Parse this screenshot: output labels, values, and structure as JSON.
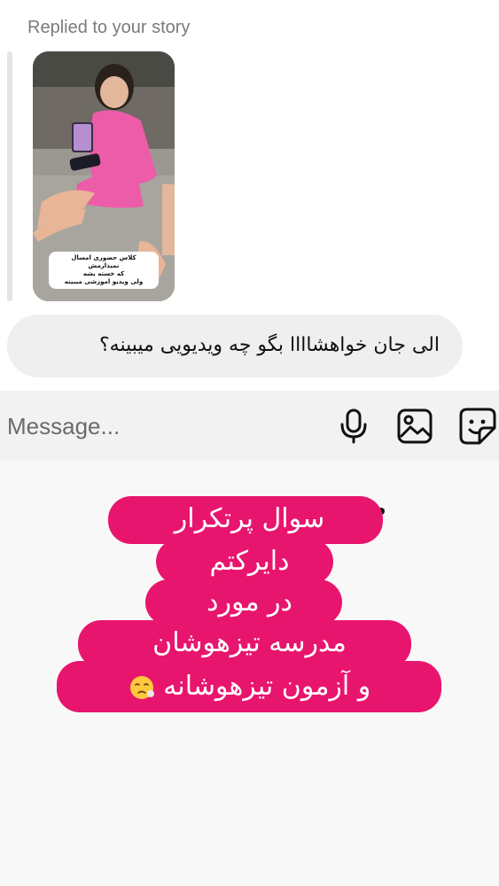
{
  "story": {
    "replied_label": "Replied to your story",
    "caption_lines": [
      "کلاس حضوری امسال",
      "نمیذارمش",
      "که خسته بشه",
      "ولی ویدیو اموزشی میبینه"
    ]
  },
  "reply": {
    "text": "الی جان خواهشاااا بگو چه ویدیویی میبینه؟"
  },
  "composer": {
    "placeholder": "Message...",
    "icons": [
      "microphone-icon",
      "gallery-icon",
      "sticker-icon"
    ]
  },
  "headline": {
    "lines": [
      "سوال پرتکرار",
      "دایرکتم",
      "در مورد",
      "مدرسه تیزهوشان",
      "و آزمون تیزهوشانه"
    ],
    "emoji": "worried-face-emoji"
  },
  "colors": {
    "accent": "#e8156e",
    "bubble": "#efefef",
    "composer_bg": "#f2f2f2",
    "lower_bg": "#f8f8f8"
  }
}
